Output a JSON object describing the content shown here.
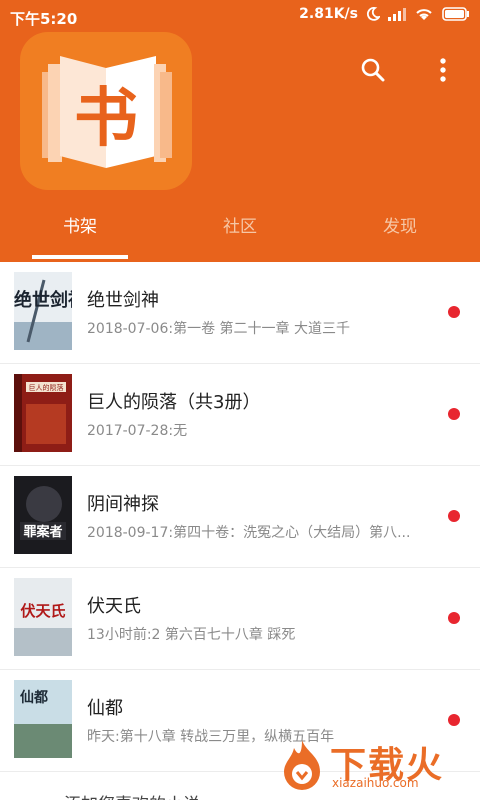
{
  "statusbar": {
    "time": "下午5:20",
    "network_speed": "2.81K/s",
    "icons": [
      "moon-icon",
      "signal-icon",
      "wifi-icon",
      "battery-icon"
    ]
  },
  "header": {
    "logo_char": "书",
    "icons": [
      "search-icon",
      "more-vert-icon"
    ],
    "colors": {
      "brand": "#e8631c",
      "logo_bg": "#f07e22"
    }
  },
  "tabs": [
    {
      "label": "书架",
      "active": true
    },
    {
      "label": "社区",
      "active": false
    },
    {
      "label": "发现",
      "active": false
    }
  ],
  "books": [
    {
      "title": "绝世剑神",
      "subtitle": "2018-07-06:第一卷 第二十一章 大道三千",
      "cover_text": "绝世剑神",
      "unread": true
    },
    {
      "title": "巨人的陨落（共3册）",
      "subtitle": "2017-07-28:无",
      "cover_text": "巨人的陨落",
      "unread": true
    },
    {
      "title": "阴间神探",
      "subtitle": "2018-09-17:第四十卷：洗冤之心（大结局）第八...",
      "cover_text": "罪案者",
      "unread": true
    },
    {
      "title": "伏天氏",
      "subtitle": "13小时前:2 第六百七十八章 踩死",
      "cover_text": "伏天氏",
      "unread": true
    },
    {
      "title": "仙都",
      "subtitle": "昨天:第十八章 转战三万里，纵横五百年",
      "cover_text": "仙都",
      "unread": true
    }
  ],
  "footer_peek": "添加您喜欢的小说",
  "watermark": {
    "text": "下载火",
    "url": "xiazaihuo.com"
  }
}
